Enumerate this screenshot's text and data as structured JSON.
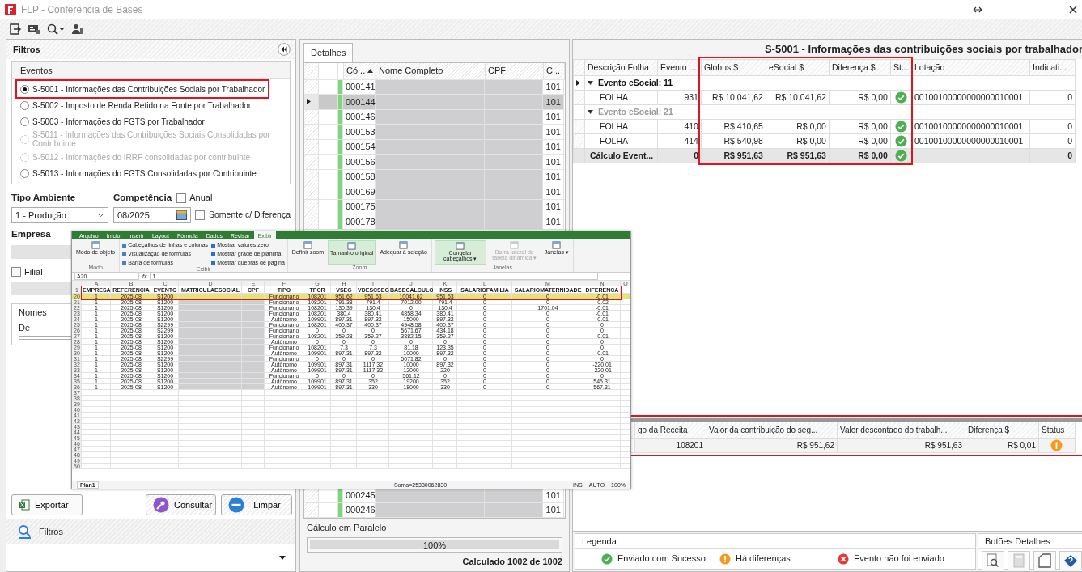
{
  "window": {
    "title": "FLP - Conferência de Bases"
  },
  "filters": {
    "title": "Filtros",
    "events": {
      "title": "Eventos",
      "options": [
        {
          "label": "S-5001 - Informações das Contribuições Sociais por Trabalhador",
          "selected": true,
          "disabled": false,
          "highlighted": true
        },
        {
          "label": "S-5002 - Imposto de Renda Retido na Fonte por Trabalhador",
          "selected": false,
          "disabled": false,
          "highlighted": false
        },
        {
          "label": "S-5003 - Informações do FGTS por Trabalhador",
          "selected": false,
          "disabled": false,
          "highlighted": false
        },
        {
          "label": "S-5011 - Informações das Contribuições Sociais Consolidadas por Contribuinte",
          "selected": false,
          "disabled": true,
          "highlighted": false
        },
        {
          "label": "S-5012 - Informações do IRRF consolidadas por contribuinte",
          "selected": false,
          "disabled": true,
          "highlighted": false
        },
        {
          "label": "S-5013 - Informações do FGTS Consolidadas por Contribuinte",
          "selected": false,
          "disabled": false,
          "highlighted": false
        }
      ]
    },
    "tipo_ambiente": {
      "label": "Tipo Ambiente",
      "value": "1 - Produção"
    },
    "competencia": {
      "label": "Competência",
      "value": "08/2025"
    },
    "anual": {
      "label": "Anual",
      "checked": false
    },
    "somente_diferenca": {
      "label": "Somente c/ Diferença",
      "checked": false
    },
    "empresa": {
      "label": "Empresa"
    },
    "filial": {
      "label": "Filial",
      "checked": false
    },
    "nomes": {
      "title": "Nomes",
      "from_label": "De"
    }
  },
  "actions": [
    {
      "label": "Exportar",
      "kind": "excel"
    },
    {
      "label": "Consultar",
      "kind": "search"
    },
    {
      "label": "Limpar",
      "kind": "clear"
    }
  ],
  "nav": {
    "label": "Filtros"
  },
  "details": {
    "tab": "Detalhes",
    "columns": [
      "Có...",
      "Nome Completo",
      "CPF",
      "C..."
    ],
    "rows_top": [
      {
        "code": "000141",
        "c": "101",
        "selected": false
      },
      {
        "code": "000144",
        "c": "101",
        "selected": true
      },
      {
        "code": "000146",
        "c": "101",
        "selected": false
      },
      {
        "code": "000153",
        "c": "101",
        "selected": false
      },
      {
        "code": "000154",
        "c": "101",
        "selected": false
      },
      {
        "code": "000156",
        "c": "101",
        "selected": false
      },
      {
        "code": "000158",
        "c": "101",
        "selected": false
      },
      {
        "code": "000169",
        "c": "101",
        "selected": false
      },
      {
        "code": "000175",
        "c": "101",
        "selected": false
      },
      {
        "code": "000178",
        "c": "101",
        "selected": false
      }
    ],
    "rows_bottom": [
      {
        "code": "000245",
        "c": "101",
        "selected": false
      },
      {
        "code": "000246",
        "c": "101",
        "selected": false
      }
    ],
    "progress": {
      "title": "Cálculo em Paralelo",
      "level": 1,
      "label": "100%",
      "status": "Calculado 1002 de 1002"
    }
  },
  "result": {
    "title": "S-5001 - Informações das contribuições sociais por trabalhador",
    "highlight_frame": true,
    "columns": [
      "Descrição Folha",
      "Evento ...",
      "Globus $",
      "eSocial $",
      "Diferença $",
      "St...",
      "Lotação",
      "Indicati..."
    ],
    "rows": [
      {
        "kind": "group",
        "label": "Evento eSocial: 11",
        "selected": true
      },
      {
        "kind": "data",
        "cells": [
          "FOLHA",
          "931",
          "R$ 10.041,62",
          "R$ 10.041,62",
          "R$ 0,00"
        ],
        "status": {
          "kind": "ok"
        },
        "lotacao": "00100100000000000010001",
        "indicativo": "0"
      },
      {
        "kind": "group",
        "label": "Evento eSocial: 21",
        "selected": false
      },
      {
        "kind": "data",
        "cells": [
          "FOLHA",
          "410",
          "R$ 410,65",
          "R$ 0,00",
          "R$ 0,00"
        ],
        "status": {
          "kind": "ok"
        },
        "lotacao": "00100100000000000010001",
        "indicativo": "0"
      },
      {
        "kind": "data",
        "cells": [
          "FOLHA",
          "414",
          "R$ 540,98",
          "R$ 0,00",
          "R$ 0,00"
        ],
        "status": {
          "kind": "ok"
        },
        "lotacao": "00100100000000000010001",
        "indicativo": "0"
      },
      {
        "kind": "total",
        "cells": [
          "Cálculo Event...",
          "0",
          "R$ 951,63",
          "R$ 951,63",
          "R$ 0,00"
        ],
        "status": {
          "kind": "ok"
        },
        "indicativo": "0"
      }
    ]
  },
  "receita": {
    "highlighted": true,
    "columns": [
      "go da Receita",
      "Valor da contribuição do seg...",
      "Valor descontado do trabalh...",
      "Diferença $",
      "Status"
    ],
    "rows": [
      {
        "cells": [
          "108201",
          "R$ 951,62",
          "R$ 951,63",
          "R$ 0,01"
        ],
        "status": {
          "kind": "warn"
        }
      }
    ]
  },
  "legend": {
    "title": "Legenda",
    "items": [
      {
        "kind": "ok",
        "label": "Enviado com Sucesso"
      },
      {
        "kind": "warn",
        "label": "Há diferenças"
      },
      {
        "kind": "error",
        "label": "Evento não foi enviado"
      }
    ]
  },
  "detail_buttons": {
    "title": "Botões Detalhes"
  },
  "spreadsheet": {
    "tabs": [
      {
        "label": "Arquivo",
        "selected": false
      },
      {
        "label": "Início",
        "selected": false
      },
      {
        "label": "Inserir",
        "selected": false
      },
      {
        "label": "Layout",
        "selected": false
      },
      {
        "label": "Fórmula",
        "selected": false
      },
      {
        "label": "Dados",
        "selected": false
      },
      {
        "label": "Revisar",
        "selected": false
      },
      {
        "label": "Exibir",
        "selected": true
      }
    ],
    "groups": [
      {
        "title": "Modo",
        "items": [
          {
            "kind": "big",
            "label": "Modo de objeto",
            "active": false
          }
        ]
      },
      {
        "title": "Exibir",
        "items": [
          {
            "kind": "item",
            "label": "Cabeçalhos de linhas e colunas"
          },
          {
            "kind": "item",
            "label": "Visualização de fórmulas"
          },
          {
            "kind": "item",
            "label": "Barra de fórmulas"
          },
          {
            "kind": "check",
            "label": "Mostrar valores zero",
            "checked": true
          },
          {
            "kind": "check",
            "label": "Mostrar grade de planilha",
            "checked": true
          },
          {
            "kind": "check",
            "label": "Mostrar quebras de página",
            "checked": true
          }
        ]
      },
      {
        "title": "Zoom",
        "items": [
          {
            "kind": "big",
            "label": "Definir zoom",
            "active": false
          },
          {
            "kind": "big",
            "label": "Tamanho original",
            "active": true
          },
          {
            "kind": "big",
            "label": "Adequar à seleção",
            "active": false
          }
        ]
      },
      {
        "title": "Janelas",
        "items": [
          {
            "kind": "big",
            "label": "Congelar cabeçalhos ▾",
            "active": true
          },
          {
            "kind": "big",
            "label": "Barra lateral de tabela dinâmica ▾",
            "active": false,
            "disabled": true
          },
          {
            "kind": "big",
            "label": "Janelas ▾",
            "active": false
          }
        ]
      }
    ],
    "cell_ref": "A20",
    "fx": "fx",
    "formula": "1",
    "column_letters": [
      "A",
      "B",
      "C",
      "D",
      "E",
      "F",
      "G",
      "H",
      "I",
      "J",
      "K",
      "L",
      "M",
      "N",
      "O"
    ],
    "header_row_number": "1",
    "headers": [
      "EMPRESA",
      "REFERENCIA",
      "EVENTO",
      "MATRICULAESOCIAL",
      "CPF",
      "TIPO",
      "TPCR",
      "VSEG",
      "VDESCSEG",
      "BASECALCULO",
      "INSS",
      "SALARIOFAMILIA",
      "SALARIOMATERNIDADE",
      "DIFERENCA"
    ],
    "highlight_frame": true,
    "rows": [
      {
        "n": "20",
        "highlighted": true,
        "cells": [
          "1",
          "2025-08",
          "S1200",
          "Funcionário",
          "108201",
          "951.62",
          "951.63",
          "10041.62",
          "951.63",
          "0",
          "0",
          "-0.01"
        ]
      },
      {
        "n": "21",
        "highlighted": false,
        "cells": [
          "1",
          "2025-08",
          "S1200",
          "Funcionário",
          "108201",
          "791.38",
          "791.4",
          "7012.00",
          "791.4",
          "0",
          "0",
          "-0.02"
        ]
      },
      {
        "n": "22",
        "highlighted": false,
        "cells": [
          "1",
          "2025-08",
          "S1200",
          "Funcionário",
          "108201",
          "130.39",
          "130.4",
          "0",
          "130.4",
          "0",
          "1701.04",
          "-0.01"
        ]
      },
      {
        "n": "23",
        "highlighted": false,
        "cells": [
          "1",
          "2025-08",
          "S1200",
          "Funcionário",
          "108201",
          "380.4",
          "380.41",
          "4858.34",
          "380.41",
          "0",
          "0",
          "-0.01"
        ]
      },
      {
        "n": "24",
        "highlighted": false,
        "cells": [
          "1",
          "2025-08",
          "S1200",
          "Autônomo",
          "109901",
          "897.31",
          "897.32",
          "15000",
          "897.32",
          "0",
          "0",
          "-0.01"
        ]
      },
      {
        "n": "25",
        "highlighted": false,
        "cells": [
          "1",
          "2025-08",
          "S2299",
          "Funcionário",
          "108201",
          "400.37",
          "400.37",
          "4948.58",
          "400.37",
          "0",
          "0",
          "0"
        ]
      },
      {
        "n": "26",
        "highlighted": false,
        "cells": [
          "1",
          "2025-08",
          "S2299",
          "Funcionário",
          "0",
          "0",
          "0",
          "5671.67",
          "434.18",
          "0",
          "0",
          "0"
        ]
      },
      {
        "n": "27",
        "highlighted": false,
        "cells": [
          "1",
          "2025-08",
          "S1200",
          "Funcionário",
          "108201",
          "359.28",
          "359.27",
          "3882.15",
          "359.27",
          "0",
          "0",
          "-0.01"
        ]
      },
      {
        "n": "28",
        "highlighted": false,
        "cells": [
          "1",
          "2025-08",
          "S1200",
          "Autônomo",
          "0",
          "0",
          "0",
          "0",
          "0",
          "0",
          "0",
          "0"
        ]
      },
      {
        "n": "29",
        "highlighted": false,
        "cells": [
          "1",
          "2025-08",
          "S1200",
          "Funcionário",
          "108201",
          "7.3",
          "7.3",
          "81.18",
          "123.35",
          "0",
          "0",
          "0"
        ]
      },
      {
        "n": "30",
        "highlighted": false,
        "cells": [
          "1",
          "2025-08",
          "S1200",
          "Autônomo",
          "109901",
          "897.31",
          "897.32",
          "10000",
          "897.32",
          "0",
          "0",
          "-0.01"
        ]
      },
      {
        "n": "31",
        "highlighted": false,
        "cells": [
          "1",
          "2025-08",
          "S2299",
          "Funcionário",
          "0",
          "0",
          "0",
          "5071.82",
          "0",
          "0",
          "0",
          "0"
        ]
      },
      {
        "n": "32",
        "highlighted": false,
        "cells": [
          "1",
          "2025-08",
          "S1200",
          "Autônomo",
          "109901",
          "897.31",
          "1117.32",
          "10000",
          "897.32",
          "0",
          "0",
          "-220.01"
        ]
      },
      {
        "n": "33",
        "highlighted": false,
        "cells": [
          "1",
          "2025-08",
          "S1200",
          "Autônomo",
          "109901",
          "897.31",
          "1117.32",
          "12000",
          "220",
          "0",
          "0",
          "-220.01"
        ]
      },
      {
        "n": "34",
        "highlighted": false,
        "cells": [
          "1",
          "2025-08",
          "S1200",
          "Funcionário",
          "0",
          "0",
          "0",
          "561.12",
          "0",
          "0",
          "0",
          "0"
        ]
      },
      {
        "n": "35",
        "highlighted": false,
        "cells": [
          "1",
          "2025-08",
          "S1200",
          "Autônomo",
          "109901",
          "897.31",
          "352",
          "19200",
          "352",
          "0",
          "0",
          "545.31"
        ]
      },
      {
        "n": "36",
        "highlighted": false,
        "cells": [
          "1",
          "2025-08",
          "S1200",
          "Autônomo",
          "109901",
          "897.31",
          "330",
          "18000",
          "330",
          "0",
          "0",
          "567.31"
        ]
      }
    ],
    "empty_row_numbers": [
      "37",
      "38",
      "39",
      "40",
      "41",
      "42",
      "43",
      "44",
      "45",
      "46",
      "47",
      "48",
      "49",
      "50"
    ],
    "sheet_tab": "Plan1",
    "sum": "Soma=25330062830",
    "mode_ins": "INS",
    "mode_auto": "AUTO",
    "zoom": "100%"
  }
}
